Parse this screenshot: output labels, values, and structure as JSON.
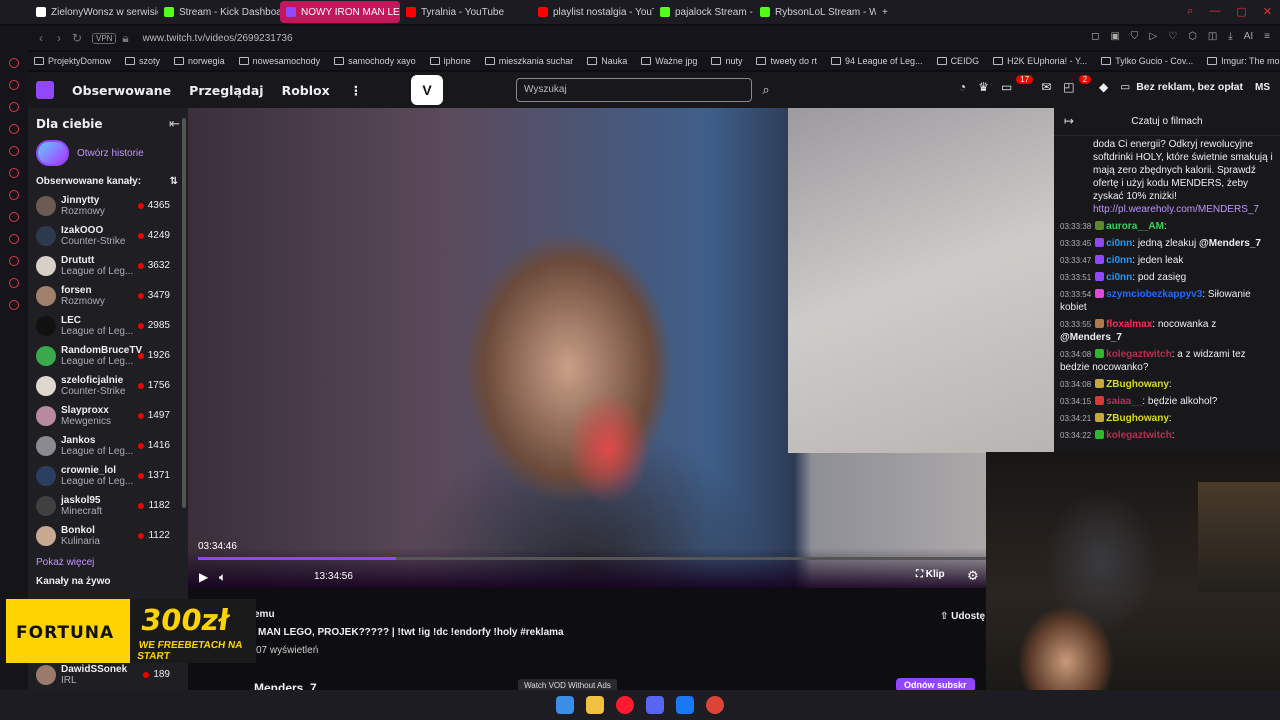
{
  "browser": {
    "tabs": [
      {
        "label": "ZielonyWonsz w serwisie",
        "color": "#ffffff",
        "active": false
      },
      {
        "label": "Stream - Kick Dashboard",
        "color": "#53fc18",
        "active": false
      },
      {
        "label": "NOWY IRON MAN LEGO,",
        "color": "#9147ff",
        "active": true
      },
      {
        "label": "Tyralnia - YouTube",
        "color": "#ff0000",
        "active": false
      },
      {
        "label": "playlist nostalgia - YouTub",
        "color": "#ff0000",
        "active": false
      },
      {
        "label": "pajalock Stream - Watch L",
        "color": "#53fc18",
        "active": false
      },
      {
        "label": "RybsonLoL Stream - Watc",
        "color": "#53fc18",
        "active": false
      }
    ],
    "new_tab": "+",
    "url": "www.twitch.tv/videos/2699231736",
    "vpn": "VPN",
    "ai_label": "AI",
    "bookmarks": [
      "ProjektyDomow",
      "szoty",
      "norwegia",
      "nowesamochody",
      "samochody xayo",
      "iphone",
      "mieszkania suchar",
      "Nauka",
      "Ważne jpg",
      "nuty",
      "tweety do rt",
      "94 League of Leg...",
      "CEIDG",
      "H2K EUphoria! - Y...",
      "Tylko Gucio - Cov...",
      "Imgur: The most a..."
    ]
  },
  "twitch_nav": {
    "following": "Obserwowane",
    "browse": "Przeglądaj",
    "roblox": "Roblox",
    "more": "⋮",
    "search_placeholder": "Wyszukaj",
    "notif_count": "17",
    "whisper_count": "2",
    "adfree": "Bez reklam, bez opłat",
    "user_initials": "MS"
  },
  "sidebar": {
    "title": "Dla ciebie",
    "story_link": "Otwórz historie",
    "followed_header": "Obserwowane kanały:",
    "channels": [
      {
        "name": "Jinnytty",
        "game": "Rozmowy",
        "viewers": "4365",
        "color": "#6b5b52"
      },
      {
        "name": "IzakOOO",
        "game": "Counter-Strike",
        "viewers": "4249",
        "color": "#2b3a4d"
      },
      {
        "name": "Drututt",
        "game": "League of Leg...",
        "viewers": "3632",
        "color": "#d8d0c8"
      },
      {
        "name": "forsen",
        "game": "Rozmowy",
        "viewers": "3479",
        "color": "#a0806a"
      },
      {
        "name": "LEC",
        "game": "League of Leg...",
        "viewers": "2985",
        "color": "#111111"
      },
      {
        "name": "RandomBruceTV",
        "game": "League of Leg...",
        "viewers": "1926",
        "color": "#3aa84b"
      },
      {
        "name": "szeloficjalnie",
        "game": "Counter-Strike",
        "viewers": "1756",
        "color": "#e0d8d0"
      },
      {
        "name": "Slayproxx",
        "game": "Mewgenics",
        "viewers": "1497",
        "color": "#b88aa0"
      },
      {
        "name": "Jankos",
        "game": "League of Leg...",
        "viewers": "1416",
        "color": "#8a8a90"
      },
      {
        "name": "crownie_lol",
        "game": "League of Leg...",
        "viewers": "1371",
        "color": "#2a3f60"
      },
      {
        "name": "jaskol95",
        "game": "Minecraft",
        "viewers": "1182",
        "color": "#404040"
      },
      {
        "name": "Bonkol",
        "game": "Kulinaria",
        "viewers": "1122",
        "color": "#c8a890"
      }
    ],
    "show_more": "Pokaż więcej",
    "live_header": "Kanały na żywo",
    "bottom_channel": {
      "name": "DawidSSonek",
      "game": "IRL",
      "viewers": "189",
      "color": "#9a7a6a"
    }
  },
  "ad": {
    "brand": "FORTUNA",
    "amount": "300zł",
    "tagline": "WE FREEBETACH NA START"
  },
  "player": {
    "time_hover": "03:34:46",
    "time_total": "13:34:56",
    "progress": 0.25,
    "clip_label": "Klip"
  },
  "video_info": {
    "line1": "emu",
    "title": "MAN LEGO, PROJEK????? | !twt !ig !dc !endorfy !holy #reklama",
    "views": "07 wyświetleń",
    "share": "Udostę",
    "streamer": "Menders_7",
    "watch_vod": "Watch VOD Without Ads",
    "subscribe": "Odnów subskr"
  },
  "chat": {
    "header": "Czatuj o filmach",
    "promo_text": "doda Ci energii? Odkryj rewolucyjne softdrinki HOLY, które świetnie smakują i mają zero zbędnych kalorii. Sprawdź ofertę i użyj kodu MENDERS, żeby zyskać 10% zniżki!",
    "promo_link": "http://pl.weareholy.com/MENDERS_7",
    "messages": [
      {
        "ts": "03:33:38",
        "user": "aurora__AM",
        "text": ":",
        "ucolor": "#3ad15a",
        "bcolor": "#5b8a2a"
      },
      {
        "ts": "03:33:45",
        "user": "ci0nn",
        "text": ": jedną zleakuj ",
        "mention": "@Menders_7",
        "ucolor": "#1e9bff",
        "bcolor": "#9147ff"
      },
      {
        "ts": "03:33:47",
        "user": "ci0nn",
        "text": ": jeden leak",
        "ucolor": "#1e9bff",
        "bcolor": "#9147ff"
      },
      {
        "ts": "03:33:51",
        "user": "ci0nn",
        "text": ": pod zasięg",
        "ucolor": "#1e9bff",
        "bcolor": "#9147ff"
      },
      {
        "ts": "03:33:54",
        "user": "szymciobezkappyv3",
        "text": ": Siłowanie kobiet",
        "ucolor": "#1e69ff",
        "bcolor": "#e04ad8"
      },
      {
        "ts": "03:33:55",
        "user": "floxalmax",
        "text": ": nocowanka z ",
        "mention": "@Menders_7",
        "ucolor": "#ff2a5a",
        "bcolor": "#b07a4a"
      },
      {
        "ts": "03:34:08",
        "user": "kolegaztwitch",
        "text": ": a z widzami tez bedzie nocowanko?",
        "ucolor": "#b03050",
        "bcolor": "#2eb82e"
      },
      {
        "ts": "03:34:08",
        "user": "ZBughowany",
        "text": ":",
        "ucolor": "#d8d82a",
        "bcolor": "#c8a83a"
      },
      {
        "ts": "03:34:15",
        "user": "saiaa__",
        "text": ": będzie alkohol?",
        "ucolor": "#c02a5a",
        "bcolor": "#d83a3a"
      },
      {
        "ts": "03:34:21",
        "user": "ZBughowany",
        "text": ":",
        "ucolor": "#d8d82a",
        "bcolor": "#c8a83a"
      },
      {
        "ts": "03:34:22",
        "user": "kolegaztwitch",
        "text": ":",
        "ucolor": "#b03050",
        "bcolor": "#2eb82e"
      }
    ]
  },
  "taskbar": {
    "icons": [
      "windows-start-icon",
      "file-explorer-icon",
      "opera-icon",
      "discord-icon",
      "facebook-icon",
      "chrome-icon"
    ]
  },
  "colors": {
    "twitch_purple": "#9147ff",
    "live_red": "#eb0400",
    "active_tab": "#c2185b",
    "fortuna_yellow": "#ffd300"
  }
}
